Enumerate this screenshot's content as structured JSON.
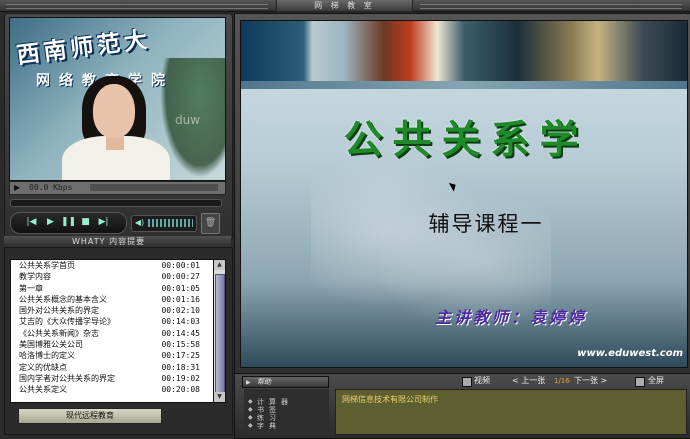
{
  "window": {
    "title": "网 梯 教 室"
  },
  "video": {
    "logo_line1": "西南师范大",
    "logo_line2": "网络教育学院",
    "watermark": "duw",
    "status_text": "00.0 Kbps",
    "play_icon": "play-triangle-icon"
  },
  "controls": {
    "prev": "|◀",
    "play": "▶",
    "pause": "❚❚",
    "stop": "■",
    "next": "▶|",
    "speaker": "◀)",
    "trash": "🗑"
  },
  "toc": {
    "header": "WHATY 内容提要",
    "items": [
      {
        "title": "公共关系学首页",
        "time": "00:00:01"
      },
      {
        "title": "教学内容",
        "time": "00:00:27"
      },
      {
        "title": "第一章",
        "time": "00:01:05"
      },
      {
        "title": "公共关系概念的基本含义",
        "time": "00:01:16"
      },
      {
        "title": "国外对公共关系的界定",
        "time": "00:02:10"
      },
      {
        "title": "艾吉的《大众传播学导论》",
        "time": "00:14:03"
      },
      {
        "title": "《公共关系新闻》杂志",
        "time": "00:14:45"
      },
      {
        "title": "美国博雅公关公司",
        "time": "00:15:58"
      },
      {
        "title": "哈洛博士的定义",
        "time": "00:17:25"
      },
      {
        "title": "定义的优缺点",
        "time": "00:18:31"
      },
      {
        "title": "国内学者对公共关系的界定",
        "time": "00:19:02"
      },
      {
        "title": "公共关系定义",
        "time": "00:20:08"
      }
    ],
    "org_button": "现代远程教育"
  },
  "slide": {
    "title": "公共关系学",
    "subtitle": "辅导课程一",
    "lecturer": "主讲教师：袁婷婷",
    "url": "www.eduwest.com"
  },
  "bottom": {
    "help_label": "帮助",
    "video_label": "视频",
    "prev_label": "< 上一张",
    "page": "1/16",
    "next_label": "下一张 >",
    "fullscreen_label": "全屏",
    "side_items": [
      "计算器",
      "书签",
      "练习",
      "字典"
    ],
    "info_text": "网梯信息技术有限公司制作"
  },
  "colors": {
    "slide_title": "#1f8a2a",
    "lecturer": "#4b2a9e",
    "info_text": "#e8d06a",
    "info_bg": "#5e5f30"
  }
}
